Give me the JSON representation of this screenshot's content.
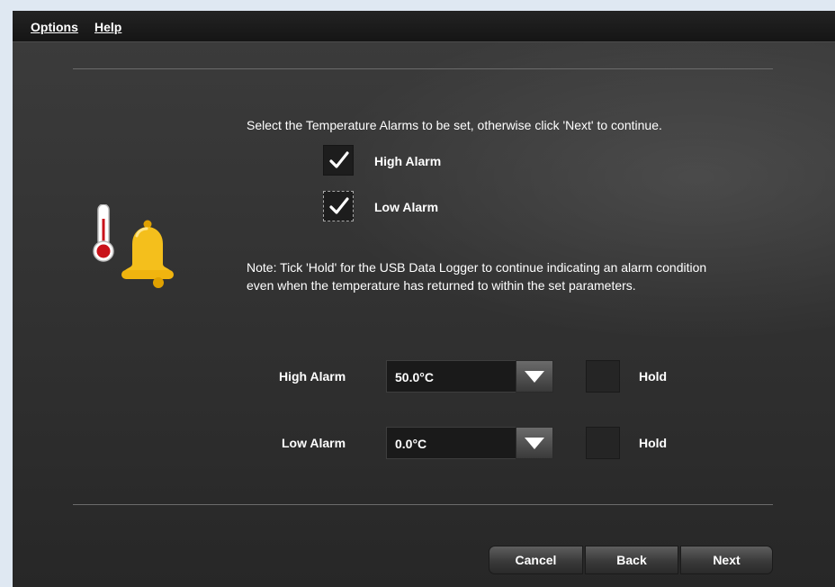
{
  "menu": {
    "options": "Options",
    "help": "Help"
  },
  "intro_text": "Select the Temperature Alarms to be set, otherwise click 'Next' to continue.",
  "alarm_checks": [
    {
      "label": "High Alarm",
      "checked": true
    },
    {
      "label": "Low Alarm",
      "checked": true
    }
  ],
  "note_text": "Note: Tick 'Hold' for the USB Data Logger to continue indicating an alarm condition even when the temperature has returned to within the set parameters.",
  "settings": {
    "high": {
      "label": "High Alarm",
      "value": "50.0°C",
      "hold_label": "Hold",
      "hold_checked": false
    },
    "low": {
      "label": "Low Alarm",
      "value": "0.0°C",
      "hold_label": "Hold",
      "hold_checked": false
    }
  },
  "buttons": {
    "cancel": "Cancel",
    "back": "Back",
    "next": "Next"
  },
  "icons": {
    "illustration": "thermometer-bell-icon",
    "dropdown": "chevron-down-icon",
    "check": "checkmark-icon"
  }
}
